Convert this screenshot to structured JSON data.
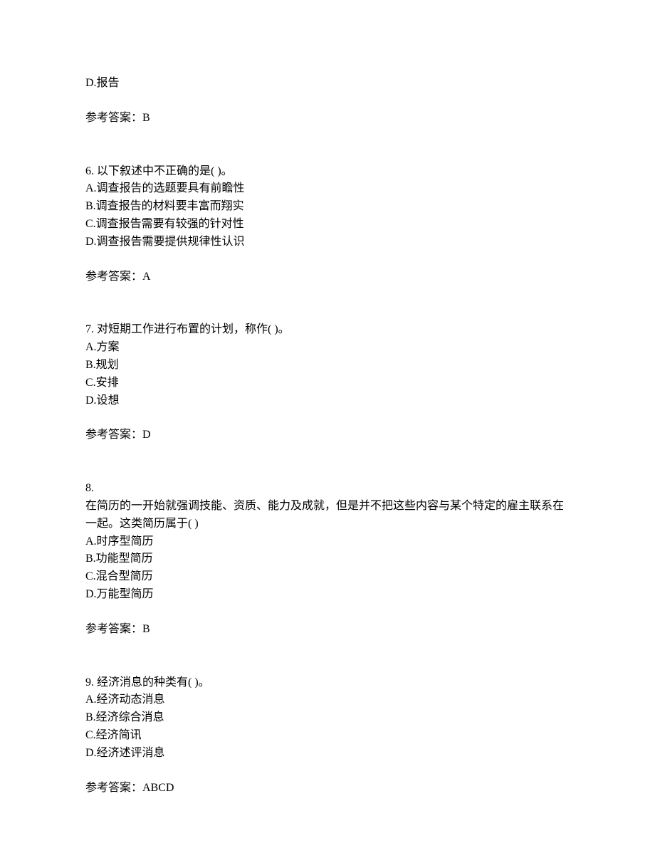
{
  "q5_partial": {
    "optionD": "D.报告",
    "answer": "参考答案：B"
  },
  "q6": {
    "stem": "6.  以下叙述中不正确的是(  )。",
    "A": "A.调查报告的选题要具有前瞻性",
    "B": "B.调查报告的材料要丰富而翔实",
    "C": "C.调查报告需要有较强的针对性",
    "D": "D.调查报告需要提供规律性认识",
    "answer": "参考答案：A"
  },
  "q7": {
    "stem": "7.  对短期工作进行布置的计划，称作(  )。",
    "A": "A.方案",
    "B": "B.规划",
    "C": "C.安排",
    "D": "D.设想",
    "answer": "参考答案：D"
  },
  "q8": {
    "num": "8.",
    "stem": "在简历的一开始就强调技能、资质、能力及成就，但是并不把这些内容与某个特定的雇主联系在一起。这类简历属于(  )",
    "A": "A.时序型简历",
    "B": "B.功能型简历",
    "C": "C.混合型简历",
    "D": "D.万能型简历",
    "answer": "参考答案：B"
  },
  "q9": {
    "stem": "9.  经济消息的种类有(  )。",
    "A": "A.经济动态消息",
    "B": "B.经济综合消息",
    "C": "C.经济简讯",
    "D": "D.经济述评消息",
    "answer": "参考答案：ABCD"
  }
}
